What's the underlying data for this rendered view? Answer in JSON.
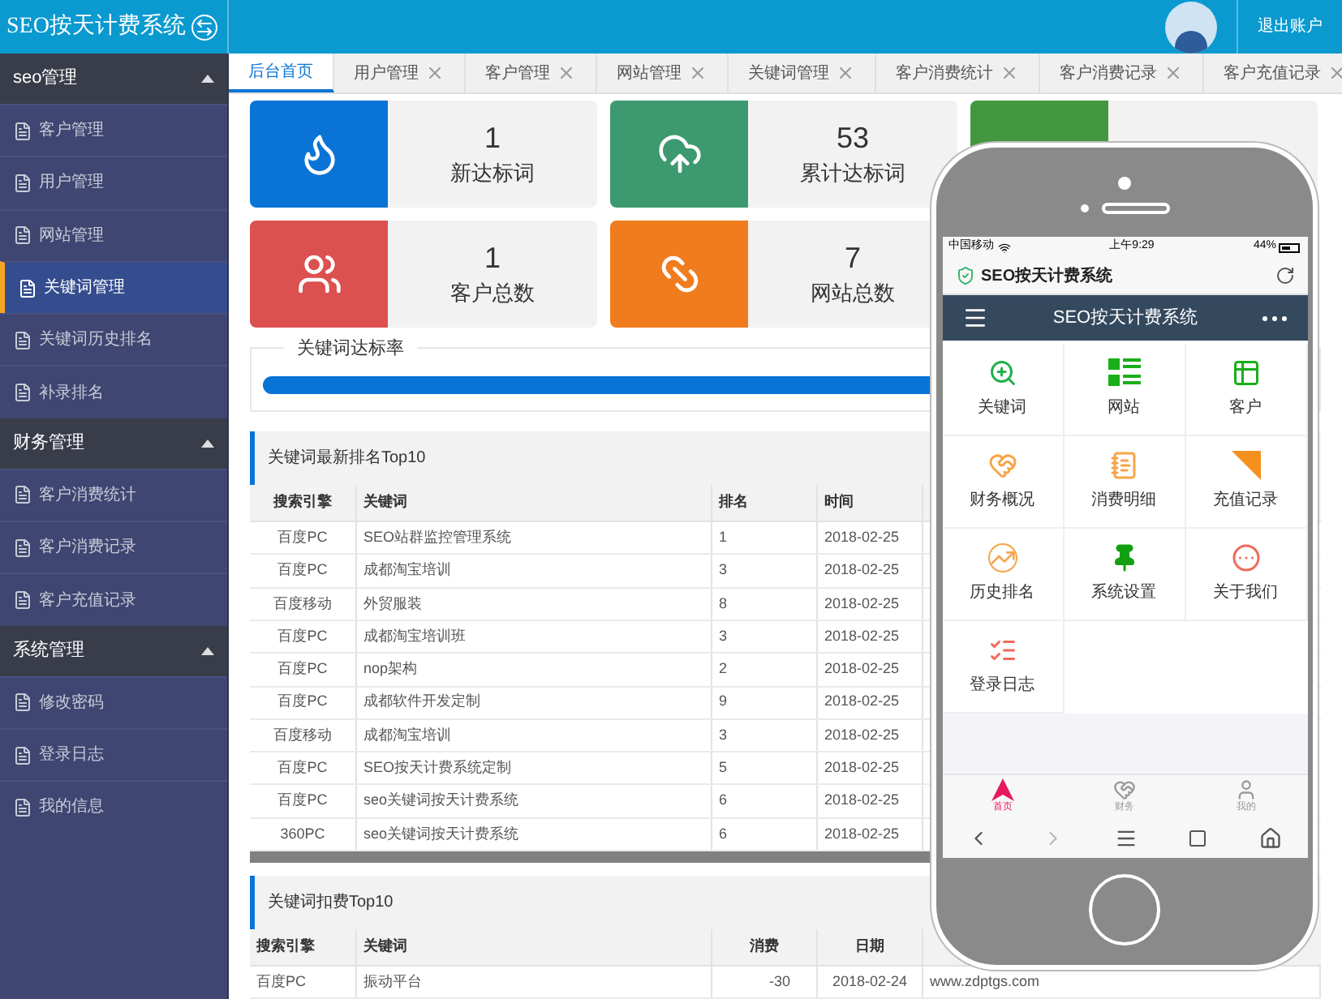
{
  "header": {
    "title": "SEO按天计费系统",
    "logout": "退出账户"
  },
  "tabs": [
    {
      "label": "后台首页",
      "selected": true,
      "closable": false
    },
    {
      "label": "用户管理",
      "selected": false,
      "closable": true
    },
    {
      "label": "客户管理",
      "selected": false,
      "closable": true
    },
    {
      "label": "网站管理",
      "selected": false,
      "closable": true
    },
    {
      "label": "关键词管理",
      "selected": false,
      "closable": true
    },
    {
      "label": "客户消费统计",
      "selected": false,
      "closable": true
    },
    {
      "label": "客户消费记录",
      "selected": false,
      "closable": true
    },
    {
      "label": "客户充值记录",
      "selected": false,
      "closable": true
    }
  ],
  "sidebar": {
    "sections": [
      {
        "title": "seo管理",
        "expanded": true,
        "items": [
          {
            "label": "客户管理",
            "selected": false
          },
          {
            "label": "用户管理",
            "selected": false
          },
          {
            "label": "网站管理",
            "selected": false
          },
          {
            "label": "关键词管理",
            "selected": true
          },
          {
            "label": "关键词历史排名",
            "selected": false
          },
          {
            "label": "补录排名",
            "selected": false
          }
        ]
      },
      {
        "title": "财务管理",
        "expanded": true,
        "items": [
          {
            "label": "客户消费统计",
            "selected": false
          },
          {
            "label": "客户消费记录",
            "selected": false
          },
          {
            "label": "客户充值记录",
            "selected": false
          }
        ]
      },
      {
        "title": "系统管理",
        "expanded": true,
        "items": [
          {
            "label": "修改密码",
            "selected": false
          },
          {
            "label": "登录日志",
            "selected": false
          },
          {
            "label": "我的信息",
            "selected": false
          }
        ]
      }
    ]
  },
  "stats": [
    {
      "kind": "flame",
      "value": "1",
      "label": "新达标词",
      "color": "#0a74d6"
    },
    {
      "kind": "cloud",
      "value": "53",
      "label": "累计达标词",
      "color": "#3d9970"
    },
    {
      "kind": "hidden",
      "color": "#43973f"
    },
    {
      "kind": "users",
      "value": "1",
      "label": "客户总数",
      "color": "#dd5050"
    },
    {
      "kind": "link",
      "value": "7",
      "label": "网站总数",
      "color": "#f07c1e"
    }
  ],
  "progress": {
    "title": "关键词达标率",
    "level": 1
  },
  "ranking": {
    "title": "关键词最新排名Top10",
    "columns": [
      "搜索引擎",
      "关键词",
      "排名",
      "时间"
    ],
    "rows": [
      [
        "百度PC",
        "SEO站群监控管理系统",
        "1",
        "2018-02-25"
      ],
      [
        "百度PC",
        "成都淘宝培训",
        "3",
        "2018-02-25"
      ],
      [
        "百度移动",
        "外贸服装",
        "8",
        "2018-02-25"
      ],
      [
        "百度PC",
        "成都淘宝培训班",
        "3",
        "2018-02-25"
      ],
      [
        "百度PC",
        "nop架构",
        "2",
        "2018-02-25"
      ],
      [
        "百度PC",
        "成都软件开发定制",
        "9",
        "2018-02-25"
      ],
      [
        "百度移动",
        "成都淘宝培训",
        "3",
        "2018-02-25"
      ],
      [
        "百度PC",
        "SEO按天计费系统定制",
        "5",
        "2018-02-25"
      ],
      [
        "百度PC",
        "seo关键词按天计费系统",
        "6",
        "2018-02-25"
      ],
      [
        "360PC",
        "seo关键词按天计费系统",
        "6",
        "2018-02-25"
      ]
    ]
  },
  "charges": {
    "title": "关键词扣费Top10",
    "columns": [
      "搜索引擎",
      "关键词",
      "消费",
      "日期"
    ],
    "rows": [
      [
        "百度PC",
        "振动平台",
        "-30",
        "2018-02-24",
        "www.zdptgs.com"
      ]
    ]
  },
  "phone": {
    "carrier": "中国移动",
    "time": "上午9:29",
    "battery": "44%",
    "browser_title": "SEO按天计费系统",
    "app_title": "SEO按天计费系统",
    "menu": [
      {
        "kind": "search",
        "label": "关键词",
        "color": "#22b14c"
      },
      {
        "kind": "list",
        "label": "网站",
        "color": "#1aae1a"
      },
      {
        "kind": "table",
        "label": "客户",
        "color": "#1aae1a"
      },
      {
        "kind": "heart",
        "label": "财务概况",
        "color": "#f5a54a"
      },
      {
        "kind": "note",
        "label": "消费明细",
        "color": "#f5a54a"
      },
      {
        "kind": "flag",
        "label": "充值记录",
        "color": "#f5901e"
      },
      {
        "kind": "trend",
        "label": "历史排名",
        "color": "#f5a54a"
      },
      {
        "kind": "pin",
        "label": "系统设置",
        "color": "#12a012"
      },
      {
        "kind": "menu",
        "label": "关于我们",
        "color": "#f06a5a"
      },
      {
        "kind": "checklist",
        "label": "登录日志",
        "color": "#f06a5a"
      }
    ],
    "tabbar": [
      {
        "kind": "home",
        "label": "首页",
        "selected": true
      },
      {
        "kind": "heart",
        "label": "财务",
        "selected": false
      },
      {
        "kind": "user",
        "label": "我的",
        "selected": false
      }
    ]
  }
}
